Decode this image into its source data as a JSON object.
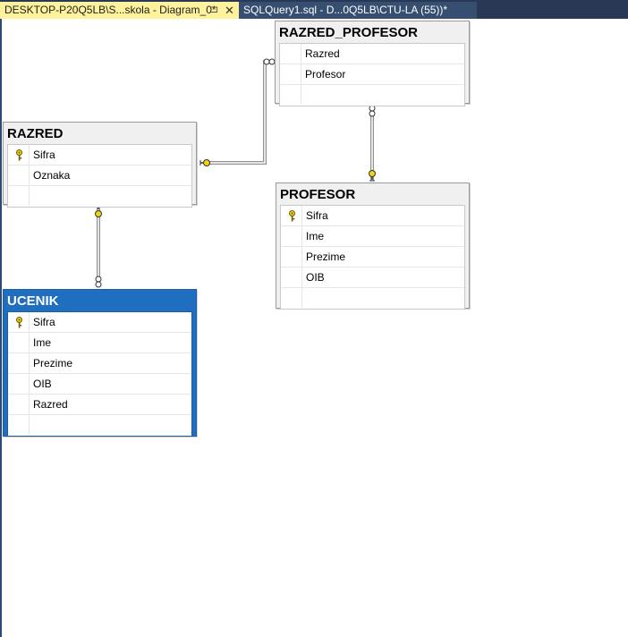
{
  "tabs": {
    "diagram": {
      "label": "DESKTOP-P20Q5LB\\S...skola - Diagram_0*",
      "pin": "⊐",
      "close": "✕"
    },
    "sql": {
      "label": "SQLQuery1.sql - D...0Q5LB\\CTU-LA (55))*"
    }
  },
  "tables": {
    "razred_profesor": {
      "title": "RAZRED_PROFESOR",
      "columns": [
        "Razred",
        "Profesor"
      ]
    },
    "razred": {
      "title": "RAZRED",
      "columns": [
        "Sifra",
        "Oznaka"
      ]
    },
    "profesor": {
      "title": "PROFESOR",
      "columns": [
        "Sifra",
        "Ime",
        "Prezime",
        "OIB"
      ]
    },
    "ucenik": {
      "title": "UCENIK",
      "columns": [
        "Sifra",
        "Ime",
        "Prezime",
        "OIB",
        "Razred"
      ]
    }
  },
  "colors": {
    "selected_table": "#1f6ebf",
    "tab_active": "#fff29d",
    "tab_bar": "#293955",
    "key_icon": "#f2d40f"
  },
  "icons": {
    "primary_key": "key-icon",
    "relationship_one": "key-end-icon",
    "relationship_many": "infinity-end-icon"
  }
}
